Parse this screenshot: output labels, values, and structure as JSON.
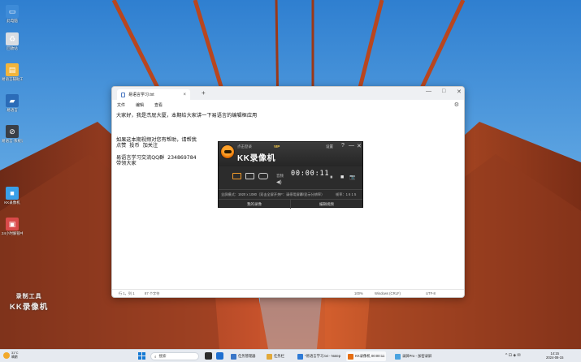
{
  "desktop": {
    "icons": [
      {
        "label": "此电脑",
        "glyph": "▭",
        "color": "#3d8bd8"
      },
      {
        "label": "回收站",
        "glyph": "♻",
        "color": "#d9dde3"
      },
      {
        "label": "易语言辅助工具",
        "glyph": "▤",
        "color": "#f2b53b"
      },
      {
        "label": "易语言",
        "glyph": "▰",
        "color": "#2b6cb8"
      },
      {
        "label": "易语言·系统设置",
        "glyph": "⊘",
        "color": "#3a3f47"
      },
      {
        "label": "KK录像机",
        "glyph": "■",
        "color": "#3aa0e8"
      },
      {
        "label": "24小时解锁中心",
        "glyph": "▣",
        "color": "#d94a4a"
      }
    ]
  },
  "notepad": {
    "tab_title": "易语言学习.txt",
    "new_tab": "+",
    "close_tab": "×",
    "controls": {
      "minimize": "—",
      "maximize": "□",
      "close": "✕"
    },
    "menu": [
      "文件",
      "编辑",
      "查看"
    ],
    "settings_icon": "⚙",
    "text": "大家好，我是杰屁大厦，本期给大家讲一下易语言的编辑框应用\n\n\n\n如果这本期视频对您有帮助，请帮我\n点赞  投币  加关注\n\n易语言学习交流QQ群  234869784\n带领大家",
    "status": {
      "position": "行 1，列 1",
      "chars": "87 个字符",
      "zoom": "100%",
      "line_ending": "Windows (CRLF)",
      "encoding": "UTF-8"
    }
  },
  "recorder": {
    "brand": "KK录像机",
    "login": "点击登录",
    "vip": "VIP",
    "settings": "设置",
    "help": "?",
    "minimize": "—",
    "close": "✕",
    "audio_label": "音频",
    "timer": "00:00:11",
    "pause": "⏸",
    "stop": "■",
    "camera": "📷",
    "info_mode": "全屏模式：1920 x 1080（双击全屏开关F：请停用屏幕/显示分辨率）",
    "info_fps": "帧率：1 6 1 5",
    "bottom_buttons": [
      "我的录像",
      "编辑视频"
    ]
  },
  "watermark": {
    "line1": "录制工具",
    "line2": "KK录像机"
  },
  "taskbar": {
    "weather_temp": "31°C",
    "weather_desc": "晴朗",
    "search_placeholder": "搜索",
    "apps": [
      {
        "label": "任务管理器",
        "color": "#3a76c8"
      },
      {
        "label": "任务栏",
        "color": "#e2a93a"
      },
      {
        "label": "*易语言学习.txt - Notep",
        "color": "#2f7bd6"
      },
      {
        "label": "KK录像机 00:00:11",
        "color": "#e56d12"
      },
      {
        "label": "录屏Pro - 加密录屏",
        "color": "#4aa3e0"
      }
    ],
    "tray": "^ ⊡ ◈ ✉",
    "time": "14:15",
    "date": "2024-08-15"
  }
}
